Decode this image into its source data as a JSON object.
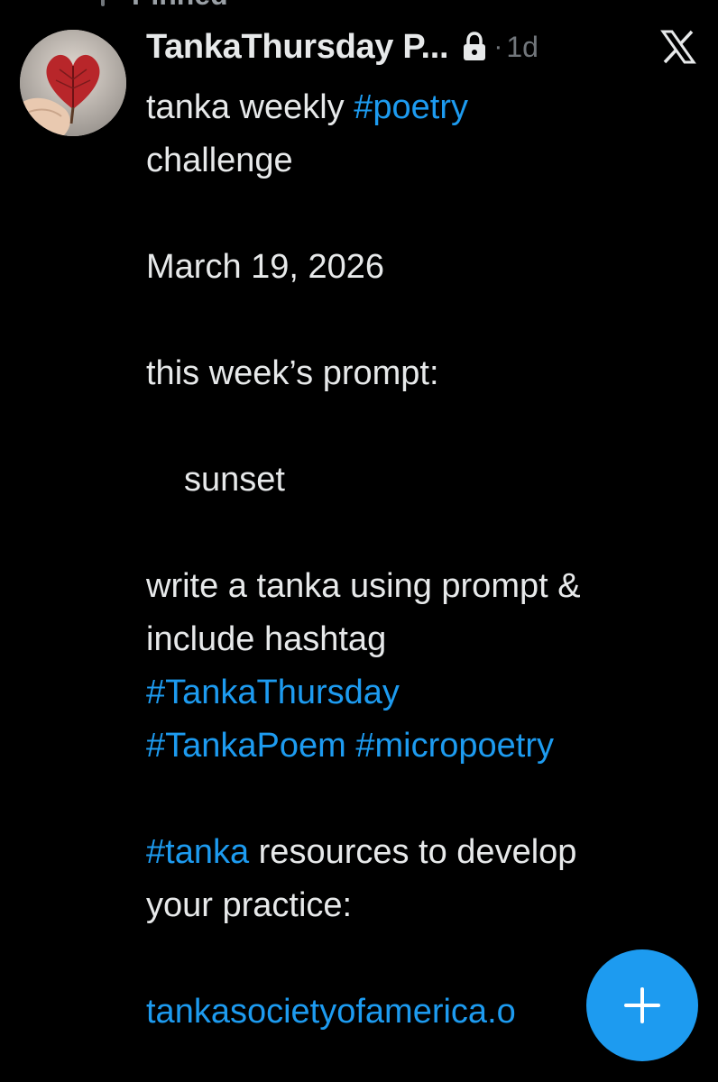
{
  "pinned": {
    "label": "Pinned"
  },
  "post": {
    "author": {
      "display_name": "TankaThursday P...",
      "avatar_icon": "heart-leaf-avatar"
    },
    "separator": "·",
    "timestamp": "1d",
    "protected_icon": "lock-icon",
    "logo_icon": "x-logo-icon",
    "body": {
      "line1_text": "tanka weekly ",
      "line1_tag": "#poetry",
      "line2_text": "challenge",
      "date": "March 19, 2026",
      "prompt_label": "this week’s prompt:",
      "prompt_word": "sunset",
      "instruction_line1": "write a tanka using prompt &",
      "instruction_line2": "include hashtag",
      "tag_tanka_thursday": "#TankaThursday",
      "tag_tanka_poem": "#TankaPoem",
      "tag_micropoetry": "#micropoetry",
      "tag_tanka": "#tanka",
      "resources_text": " resources to develop",
      "resources_text2": "your practice:",
      "link": "tankasocietyofamerica.o"
    }
  },
  "compose_button": {
    "icon": "plus-icon"
  },
  "colors": {
    "background": "#000000",
    "text": "#e7e9ea",
    "muted": "#71767b",
    "accent": "#1d9bf0"
  }
}
